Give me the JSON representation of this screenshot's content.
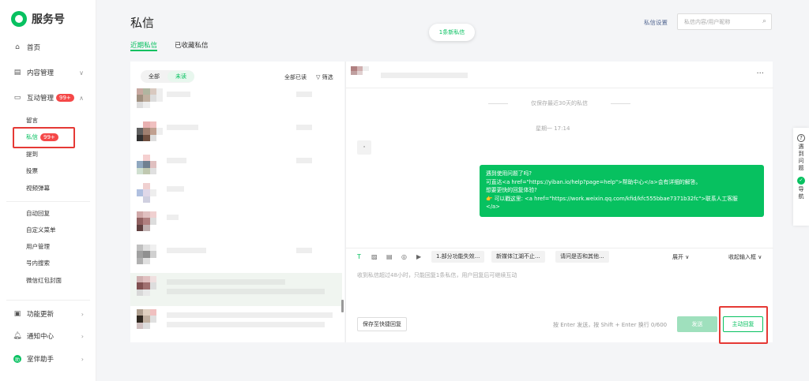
{
  "app": {
    "name": "服务号"
  },
  "nav": {
    "home": "首页",
    "content": "内容管理",
    "interact": "互动管理",
    "interact_badge": "99+",
    "sub": {
      "comments": "留言",
      "messages": "私信",
      "messages_badge": "99+",
      "mentions": "提到",
      "votes": "投票",
      "video_bullets": "视频弹幕"
    },
    "group2": [
      "自动回复",
      "自定义菜单",
      "用户管理",
      "号内搜索",
      "微信红包封面"
    ],
    "updates": "功能更新",
    "notify": "通知中心",
    "assistant": "室伴助手"
  },
  "page": {
    "title": "私信",
    "tabs": [
      "近期私信",
      "已收藏私信"
    ],
    "toast": "1条新私信",
    "settings": "私信设置",
    "search_placeholder": "私信内容/用户昵称"
  },
  "list": {
    "filter_all": "全部",
    "filter_unread": "未读",
    "read_all": "全部已读",
    "filter": "筛选"
  },
  "chat": {
    "keep_notice": "仅保存最近30天的私信",
    "time": "星期一 17:14",
    "small_msg": "·",
    "auto_reply": [
      "遇到使用问题了吗?",
      "可直达<a href=\"https://yiban.io/help?page=help\">帮助中心</a>会有详细的解答。",
      "想要更快的回复体验?",
      "👉 可以戳这里: <a href=\"https://work.weixin.qq.com/kfid/kfc555bbae7371b32fc\">联系人工客服",
      "</a>"
    ],
    "quick_replies": [
      "1.部分功能失效...",
      "新媒体江湖不止...",
      "请问是否和其他..."
    ],
    "expand": "展开",
    "collapse": "收起输入框",
    "hint": "收到私信超过48小时，只能回复1条私信，用户回复后可继续互动",
    "save_quick": "保存至快捷回复",
    "kbd_hint": "按 Enter 发送，按 Shift + Enter 换行  0/600",
    "send": "发送",
    "active_reply": "主动回复"
  },
  "float": {
    "help": "遇到问题",
    "guide": "导航"
  },
  "colors": {
    "brand": "#07c160",
    "badge": "#f54848",
    "highlight": "#e53935"
  }
}
